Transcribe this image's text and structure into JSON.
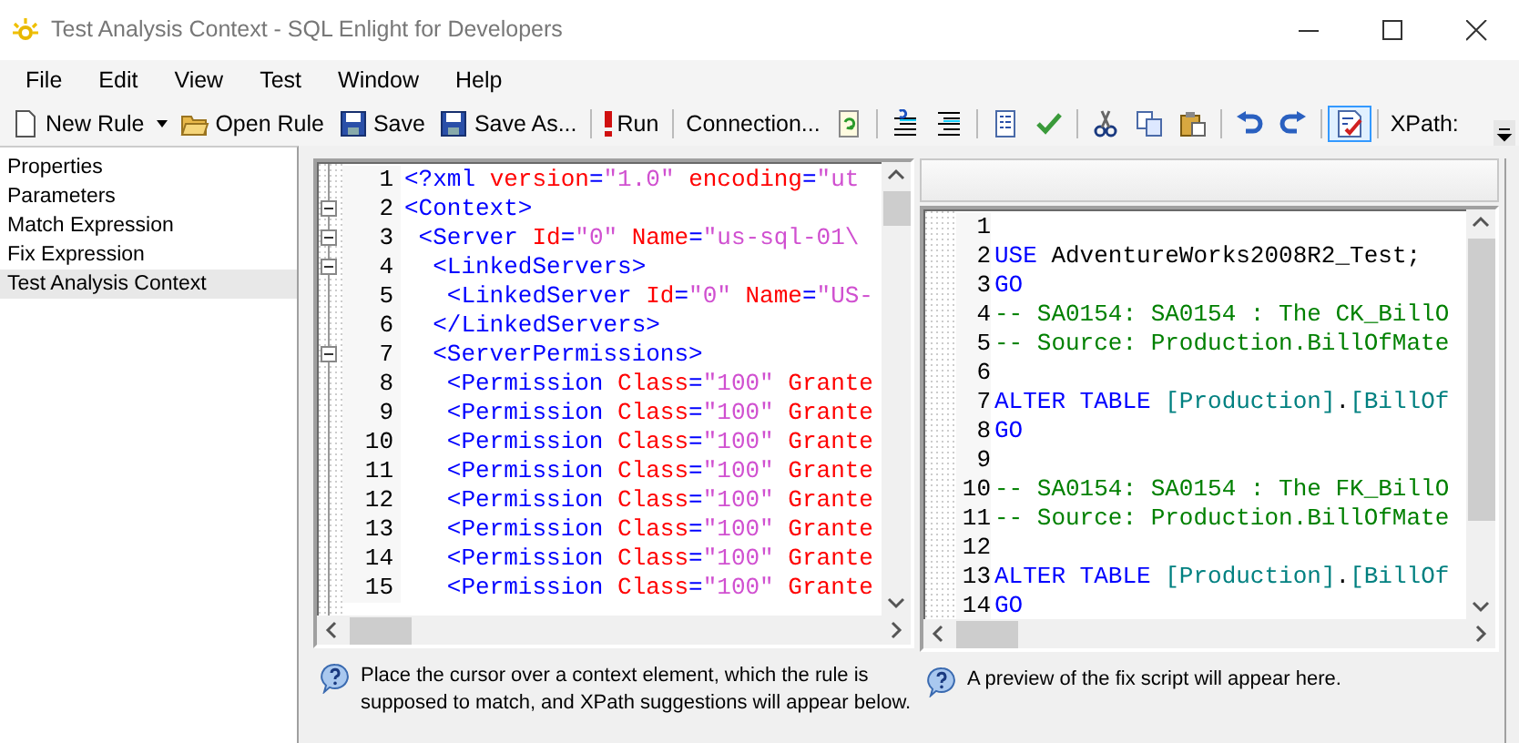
{
  "window": {
    "title": "Test Analysis Context - SQL Enlight for Developers"
  },
  "menu": [
    "File",
    "Edit",
    "View",
    "Test",
    "Window",
    "Help"
  ],
  "toolbar": [
    [
      {
        "kind": "labeled",
        "label": "New Rule"
      },
      {
        "kind": "caret"
      },
      {
        "kind": "labeled",
        "label": "Open Rule"
      },
      {
        "kind": "labeled",
        "label": "Save"
      },
      {
        "kind": "labeled",
        "label": "Save As..."
      }
    ],
    [
      {
        "kind": "labeled",
        "label": "Run"
      }
    ],
    [
      {
        "kind": "text",
        "label": "Connection..."
      },
      {
        "kind": "icon"
      }
    ],
    [
      {
        "kind": "icon"
      },
      {
        "kind": "icon"
      }
    ],
    [
      {
        "kind": "icon"
      },
      {
        "kind": "icon"
      }
    ],
    [
      {
        "kind": "icon"
      },
      {
        "kind": "icon"
      },
      {
        "kind": "icon"
      }
    ],
    [
      {
        "kind": "icon"
      },
      {
        "kind": "icon"
      }
    ],
    [
      {
        "kind": "toggle",
        "selected": true
      }
    ],
    [
      {
        "kind": "label",
        "label": "XPath:"
      }
    ]
  ],
  "sidebar": {
    "items": [
      {
        "label": "Properties",
        "selected": false
      },
      {
        "label": "Parameters",
        "selected": false
      },
      {
        "label": "Match Expression",
        "selected": false
      },
      {
        "label": "Fix Expression",
        "selected": false
      },
      {
        "label": "Test Analysis Context",
        "selected": true
      }
    ]
  },
  "context_editor": {
    "lines": [
      {
        "number": "1",
        "fold_start": false,
        "tokens": [
          {
            "kind": "tag",
            "text": "<?xml"
          },
          {
            "kind": "attr",
            "text": " version"
          },
          {
            "kind": "tag",
            "text": "="
          },
          {
            "kind": "value",
            "text": "\"1.0\""
          },
          {
            "kind": "attr",
            "text": " encoding"
          },
          {
            "kind": "tag",
            "text": "="
          },
          {
            "kind": "value",
            "text": "\"ut"
          }
        ]
      },
      {
        "number": "2",
        "fold_start": true,
        "tokens": [
          {
            "kind": "tag",
            "text": "<Context>"
          }
        ]
      },
      {
        "number": "3",
        "fold_start": true,
        "tokens": [
          {
            "kind": "tag",
            "text": " <Server"
          },
          {
            "kind": "attr",
            "text": " Id"
          },
          {
            "kind": "tag",
            "text": "="
          },
          {
            "kind": "value",
            "text": "\"0\""
          },
          {
            "kind": "attr",
            "text": " Name"
          },
          {
            "kind": "tag",
            "text": "="
          },
          {
            "kind": "value",
            "text": "\"us-sql-01\\"
          }
        ]
      },
      {
        "number": "4",
        "fold_start": true,
        "tokens": [
          {
            "kind": "tag",
            "text": "  <LinkedServers>"
          }
        ]
      },
      {
        "number": "5",
        "fold_start": false,
        "tokens": [
          {
            "kind": "tag",
            "text": "   <LinkedServer"
          },
          {
            "kind": "attr",
            "text": " Id"
          },
          {
            "kind": "tag",
            "text": "="
          },
          {
            "kind": "value",
            "text": "\"0\""
          },
          {
            "kind": "attr",
            "text": " Name"
          },
          {
            "kind": "tag",
            "text": "="
          },
          {
            "kind": "value",
            "text": "\"US-"
          }
        ]
      },
      {
        "number": "6",
        "fold_start": false,
        "tokens": [
          {
            "kind": "tag",
            "text": "  </LinkedServers>"
          }
        ]
      },
      {
        "number": "7",
        "fold_start": true,
        "tokens": [
          {
            "kind": "tag",
            "text": "  <ServerPermissions>"
          }
        ]
      },
      {
        "number": "8",
        "fold_start": false,
        "tokens": [
          {
            "kind": "tag",
            "text": "   <Permission"
          },
          {
            "kind": "attr",
            "text": " Class"
          },
          {
            "kind": "tag",
            "text": "="
          },
          {
            "kind": "value",
            "text": "\"100\""
          },
          {
            "kind": "attr",
            "text": " Grante"
          }
        ]
      },
      {
        "number": "9",
        "fold_start": false,
        "tokens": [
          {
            "kind": "tag",
            "text": "   <Permission"
          },
          {
            "kind": "attr",
            "text": " Class"
          },
          {
            "kind": "tag",
            "text": "="
          },
          {
            "kind": "value",
            "text": "\"100\""
          },
          {
            "kind": "attr",
            "text": " Grante"
          }
        ]
      },
      {
        "number": "10",
        "fold_start": false,
        "tokens": [
          {
            "kind": "tag",
            "text": "   <Permission"
          },
          {
            "kind": "attr",
            "text": " Class"
          },
          {
            "kind": "tag",
            "text": "="
          },
          {
            "kind": "value",
            "text": "\"100\""
          },
          {
            "kind": "attr",
            "text": " Grante"
          }
        ]
      },
      {
        "number": "11",
        "fold_start": false,
        "tokens": [
          {
            "kind": "tag",
            "text": "   <Permission"
          },
          {
            "kind": "attr",
            "text": " Class"
          },
          {
            "kind": "tag",
            "text": "="
          },
          {
            "kind": "value",
            "text": "\"100\""
          },
          {
            "kind": "attr",
            "text": " Grante"
          }
        ]
      },
      {
        "number": "12",
        "fold_start": false,
        "tokens": [
          {
            "kind": "tag",
            "text": "   <Permission"
          },
          {
            "kind": "attr",
            "text": " Class"
          },
          {
            "kind": "tag",
            "text": "="
          },
          {
            "kind": "value",
            "text": "\"100\""
          },
          {
            "kind": "attr",
            "text": " Grante"
          }
        ]
      },
      {
        "number": "13",
        "fold_start": false,
        "tokens": [
          {
            "kind": "tag",
            "text": "   <Permission"
          },
          {
            "kind": "attr",
            "text": " Class"
          },
          {
            "kind": "tag",
            "text": "="
          },
          {
            "kind": "value",
            "text": "\"100\""
          },
          {
            "kind": "attr",
            "text": " Grante"
          }
        ]
      },
      {
        "number": "14",
        "fold_start": false,
        "tokens": [
          {
            "kind": "tag",
            "text": "   <Permission"
          },
          {
            "kind": "attr",
            "text": " Class"
          },
          {
            "kind": "tag",
            "text": "="
          },
          {
            "kind": "value",
            "text": "\"100\""
          },
          {
            "kind": "attr",
            "text": " Grante"
          }
        ]
      },
      {
        "number": "15",
        "fold_start": false,
        "tokens": [
          {
            "kind": "tag",
            "text": "   <Permission"
          },
          {
            "kind": "attr",
            "text": " Class"
          },
          {
            "kind": "tag",
            "text": "="
          },
          {
            "kind": "value",
            "text": "\"100\""
          },
          {
            "kind": "attr",
            "text": " Grante"
          }
        ]
      }
    ],
    "hint": "Place the cursor over a context element, which the rule is supposed to match, and XPath suggestions will appear below."
  },
  "fix_preview": {
    "lines": [
      {
        "number": "1"
      },
      {
        "number": "2",
        "tokens": [
          {
            "kind": "keyword",
            "text": "USE"
          },
          {
            "kind": "plain",
            "text": " AdventureWorks2008R2_Test;"
          }
        ]
      },
      {
        "number": "3",
        "tokens": [
          {
            "kind": "keyword",
            "text": "GO"
          }
        ]
      },
      {
        "number": "4",
        "tokens": [
          {
            "kind": "comment",
            "text": "-- SA0154: SA0154 : The CK_BillO"
          }
        ]
      },
      {
        "number": "5",
        "tokens": [
          {
            "kind": "comment",
            "text": "-- Source: Production.BillOfMate"
          }
        ]
      },
      {
        "number": "6"
      },
      {
        "number": "7",
        "tokens": [
          {
            "kind": "keyword",
            "text": "ALTER TABLE"
          },
          {
            "kind": "name",
            "text": " [Production]"
          },
          {
            "kind": "plain",
            "text": "."
          },
          {
            "kind": "name",
            "text": "[BillOf"
          }
        ]
      },
      {
        "number": "8",
        "tokens": [
          {
            "kind": "keyword",
            "text": "GO"
          }
        ]
      },
      {
        "number": "9"
      },
      {
        "number": "10",
        "tokens": [
          {
            "kind": "comment",
            "text": "-- SA0154: SA0154 : The FK_BillO"
          }
        ]
      },
      {
        "number": "11",
        "tokens": [
          {
            "kind": "comment",
            "text": "-- Source: Production.BillOfMate"
          }
        ]
      },
      {
        "number": "12"
      },
      {
        "number": "13",
        "tokens": [
          {
            "kind": "keyword",
            "text": "ALTER TABLE"
          },
          {
            "kind": "name",
            "text": " [Production]"
          },
          {
            "kind": "plain",
            "text": "."
          },
          {
            "kind": "name",
            "text": "[BillOf"
          }
        ]
      },
      {
        "number": "14",
        "tokens": [
          {
            "kind": "keyword",
            "text": "GO"
          }
        ]
      }
    ],
    "hint": "A preview of the fix script will appear here."
  }
}
